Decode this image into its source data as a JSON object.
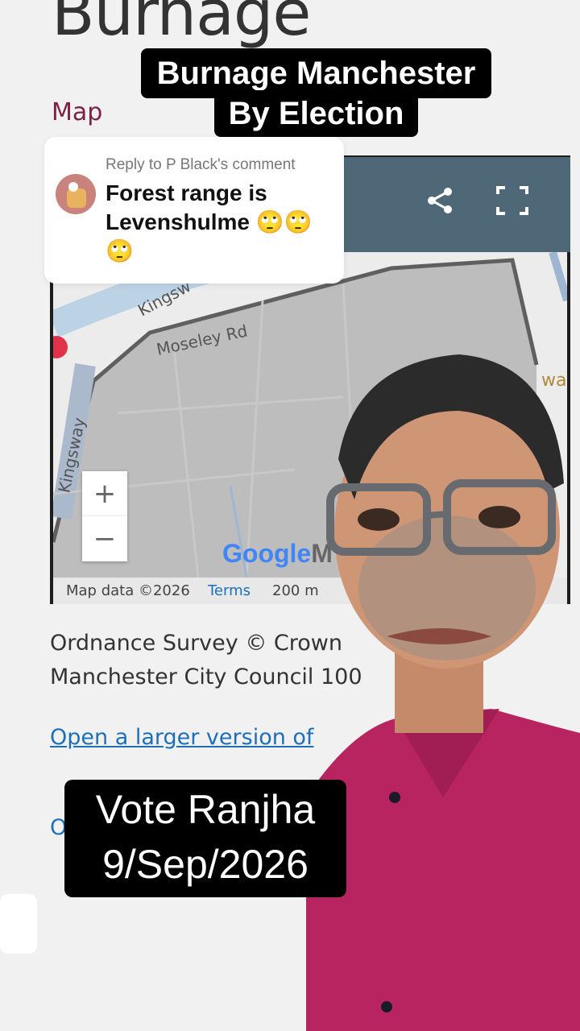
{
  "page": {
    "title": "Burnage",
    "map_section_label": "Map"
  },
  "caption_top": {
    "line1": "Burnage Manchester",
    "line2": "By Election"
  },
  "comment": {
    "context": "Reply to P Black's comment",
    "text": "Forest range is Levenshulme 🙄🙄🙄"
  },
  "map": {
    "toolbar": {
      "share_icon": "share-icon",
      "fullscreen_icon": "fullscreen-icon"
    },
    "labels": {
      "road1": "Kingsw",
      "road2": "Moseley Rd",
      "road3": "Kingsway",
      "edge": "wa"
    },
    "zoom_in": "+",
    "zoom_out": "−",
    "google_logo": "Google",
    "google_logo_tail": "M",
    "footer": {
      "map_data": "Map data ©2026",
      "terms": "Terms",
      "scale": "200 m"
    }
  },
  "attribution": {
    "line1": "Ordnance Survey © Crown",
    "line2": "Manchester City Council 100"
  },
  "larger_link": "Open a larger version of",
  "partial_link": "O",
  "caption_bottom": {
    "line1": "Vote Ranjha",
    "line2": "9/Sep/2026"
  },
  "colors": {
    "accent": "#7d2146",
    "link": "#1d70b8",
    "toolbar": "#4f6877",
    "shirt": "#b8245f"
  }
}
